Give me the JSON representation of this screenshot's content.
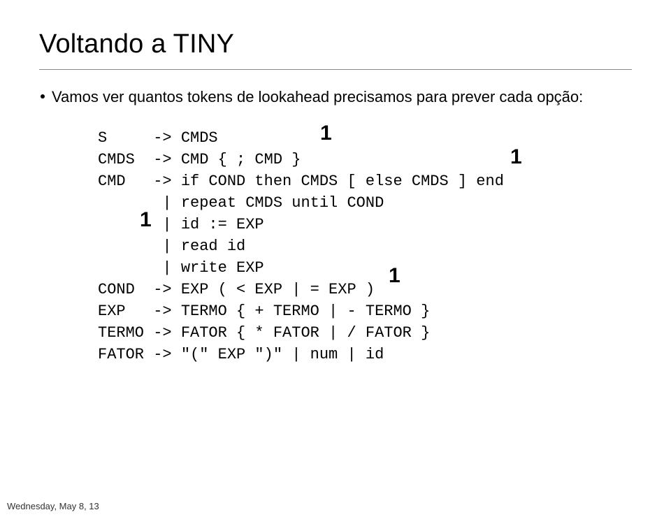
{
  "title": "Voltando a TINY",
  "bullet": "Vamos ver quantos tokens de lookahead precisamos para prever cada opção:",
  "grammar_lines": [
    "S     -> CMDS",
    "CMDS  -> CMD { ; CMD }",
    "CMD   -> if COND then CMDS [ else CMDS ] end",
    "       | repeat CMDS until COND",
    "       | id := EXP",
    "       | read id",
    "       | write EXP",
    "COND  -> EXP ( < EXP | = EXP )",
    "EXP   -> TERMO { + TERMO | - TERMO }",
    "TERMO -> FATOR { * FATOR | / FATOR }",
    "FATOR -> \"(\" EXP \")\" | num | id"
  ],
  "annotations": {
    "a1": "1",
    "a2": "1",
    "a3": "1",
    "a4": "1"
  },
  "footer": "Wednesday, May 8, 13"
}
